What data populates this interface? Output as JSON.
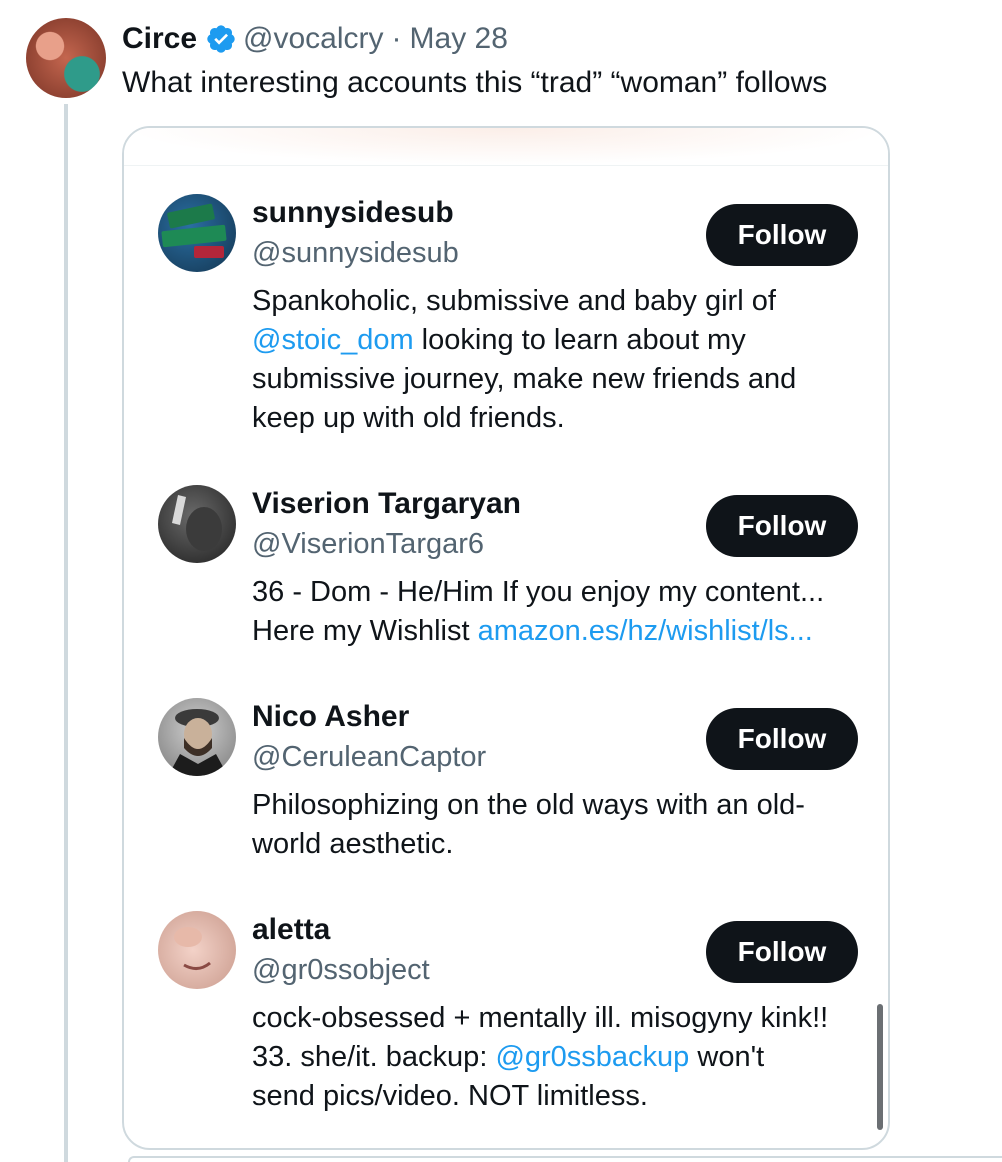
{
  "tweet": {
    "author_name": "Circe",
    "author_handle": "@vocalcry",
    "separator": "·",
    "date": "May 28",
    "text": "What interesting accounts this “trad” “woman” follows"
  },
  "colors": {
    "link": "#1d9bf0",
    "follow_bg": "#0f1419",
    "verified": "#1d9bf0",
    "secondary_text": "#536471"
  },
  "accounts": [
    {
      "name": "sunnysidesub",
      "handle": "@sunnysidesub",
      "follow_label": "Follow",
      "bio": [
        [
          {
            "t": "Spankoholic, submissive and baby girl of"
          }
        ],
        [
          {
            "t": "@stoic_dom",
            "link": true
          },
          {
            "t": " looking to learn about my"
          }
        ],
        [
          {
            "t": "submissive journey, make new friends and"
          }
        ],
        [
          {
            "t": "keep up with old friends."
          }
        ]
      ]
    },
    {
      "name": "Viserion Targaryan",
      "handle": "@ViserionTargar6",
      "follow_label": "Follow",
      "bio": [
        [
          {
            "t": "36 - Dom - He/Him If you enjoy my content..."
          }
        ],
        [
          {
            "t": "Here my Wishlist "
          },
          {
            "t": "amazon.es/hz/wishlist/ls...",
            "link": true
          }
        ]
      ]
    },
    {
      "name": "Nico Asher",
      "handle": "@CeruleanCaptor",
      "follow_label": "Follow",
      "bio": [
        [
          {
            "t": "Philosophizing on the old ways with an old-"
          }
        ],
        [
          {
            "t": "world aesthetic."
          }
        ]
      ]
    },
    {
      "name": "aletta",
      "handle": "@gr0ssobject",
      "follow_label": "Follow",
      "bio": [
        [
          {
            "t": "cock-obsessed + mentally ill. misogyny kink!!"
          }
        ],
        [
          {
            "t": "33. she/it. backup: "
          },
          {
            "t": "@gr0ssbackup",
            "link": true
          },
          {
            "t": " won't"
          }
        ],
        [
          {
            "t": "send pics/video. NOT limitless."
          }
        ]
      ]
    }
  ]
}
